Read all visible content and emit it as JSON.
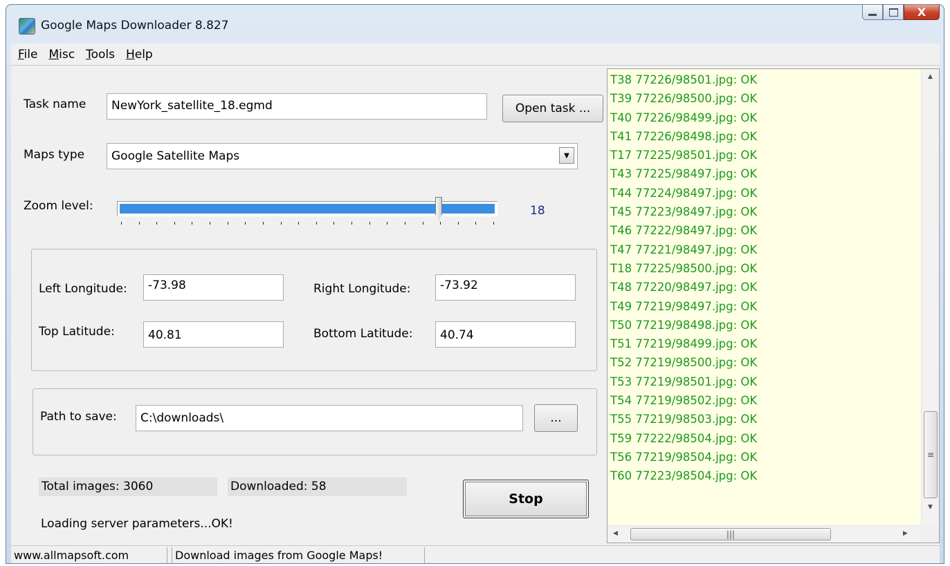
{
  "window": {
    "title": "Google Maps Downloader 8.827",
    "icon": "globe-map-icon",
    "close_glyph": "X"
  },
  "menu": [
    "File",
    "Misc",
    "Tools",
    "Help"
  ],
  "task": {
    "label": "Task name",
    "value": "NewYork_satellite_18.egmd",
    "open_button": "Open task ..."
  },
  "maps_type": {
    "label": "Maps type",
    "selected": "Google Satellite Maps"
  },
  "zoom": {
    "label": "Zoom level:",
    "value": "18",
    "min": 0,
    "max": 21,
    "level": 18
  },
  "coords": {
    "left_longitude_label": "Left Longitude:",
    "left_longitude": "-73.98",
    "right_longitude_label": "Right Longitude:",
    "right_longitude": "-73.92",
    "top_latitude_label": "Top Latitude:",
    "top_latitude": "40.81",
    "bottom_latitude_label": "Bottom Latitude:",
    "bottom_latitude": "40.74"
  },
  "save": {
    "label": "Path to save:",
    "path": "C:\\downloads\\",
    "browse_button": "..."
  },
  "stats": {
    "total": "Total images: 3060",
    "downloaded": "Downloaded: 58",
    "status": "Loading server parameters...OK!"
  },
  "stop_button": "Stop",
  "log": [
    "T38 77226/98501.jpg: OK",
    "T39 77226/98500.jpg: OK",
    "T40 77226/98499.jpg: OK",
    "T41 77226/98498.jpg: OK",
    "T17 77225/98501.jpg: OK",
    "T43 77225/98497.jpg: OK",
    "T44 77224/98497.jpg: OK",
    "T45 77223/98497.jpg: OK",
    "T46 77222/98497.jpg: OK",
    "T47 77221/98497.jpg: OK",
    "T18 77225/98500.jpg: OK",
    "T48 77220/98497.jpg: OK",
    "T49 77219/98497.jpg: OK",
    "T50 77219/98498.jpg: OK",
    "T51 77219/98499.jpg: OK",
    "T52 77219/98500.jpg: OK",
    "T53 77219/98501.jpg: OK",
    "T54 77219/98502.jpg: OK",
    "T55 77219/98503.jpg: OK",
    "T59 77222/98504.jpg: OK",
    "T56 77219/98504.jpg: OK",
    "T60 77223/98504.jpg: OK"
  ],
  "status_bar": {
    "website": "www.allmapsoft.com",
    "message": "Download images from Google Maps!"
  },
  "colors": {
    "log_text": "#1c9a1c",
    "log_background": "#ffffe5",
    "slider_fill": "#3a8fe0",
    "zoom_value": "#1a2a8a"
  }
}
